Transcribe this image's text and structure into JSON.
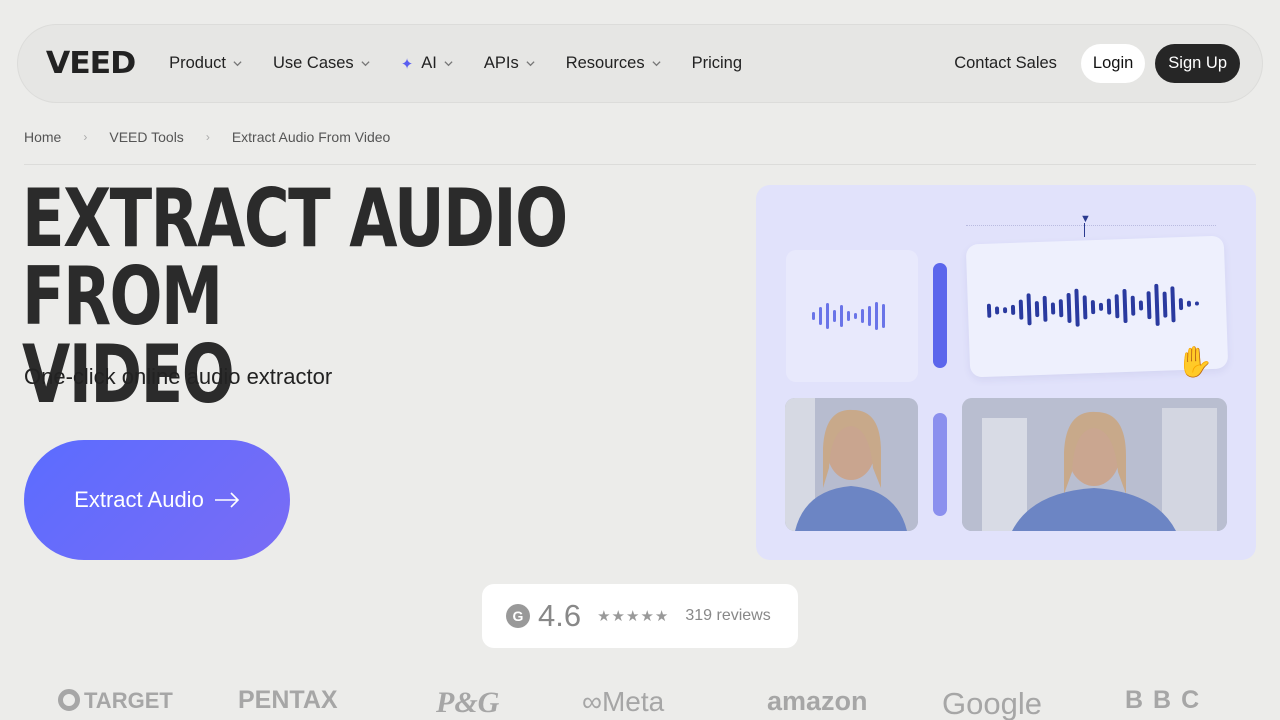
{
  "nav": {
    "logo": "VEED",
    "items": [
      {
        "label": "Product",
        "dropdown": true
      },
      {
        "label": "Use Cases",
        "dropdown": true
      },
      {
        "label": "AI",
        "dropdown": true,
        "icon": "sparkle-icon"
      },
      {
        "label": "APIs",
        "dropdown": true
      },
      {
        "label": "Resources",
        "dropdown": true
      },
      {
        "label": "Pricing",
        "dropdown": false
      }
    ],
    "contact": "Contact Sales",
    "login": "Login",
    "signup": "Sign Up"
  },
  "breadcrumb": [
    "Home",
    "VEED Tools",
    "Extract Audio From Video"
  ],
  "hero": {
    "title_line1": "EXTRACT AUDIO FROM",
    "title_line2": "VIDEO",
    "subtitle": "One-click online audio extractor",
    "cta": "Extract Audio",
    "cta_icon": "arrow-right-icon"
  },
  "rating": {
    "badge": "G",
    "score": "4.6",
    "stars": "★★★★★",
    "reviews": "319 reviews"
  },
  "logos": [
    "TARGET",
    "PENTAX",
    "P&G",
    "Meta",
    "amazon",
    "Google",
    "BBC"
  ],
  "colors": {
    "accent": "#5b6cff",
    "background": "#ececea",
    "dark_button": "#262626",
    "waveform": "#2a3a9f",
    "illustration_bg": "#e1e2fb"
  }
}
